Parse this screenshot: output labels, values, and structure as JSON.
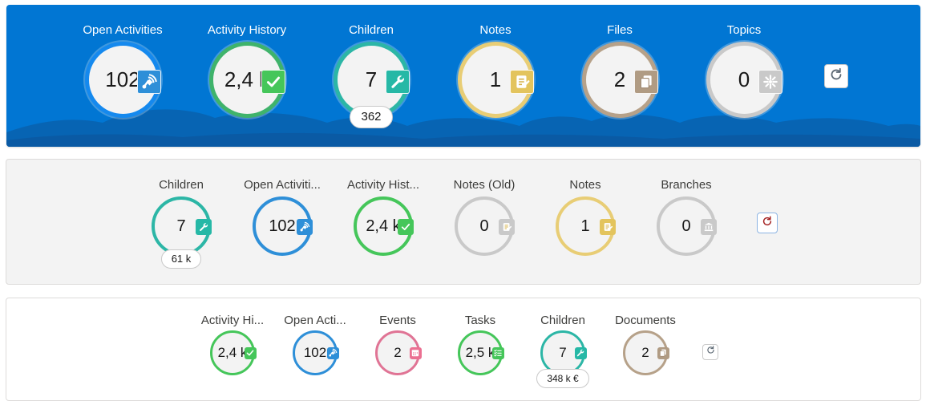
{
  "panels": [
    {
      "style": "blue",
      "tiles": [
        {
          "label": "Open Activities",
          "value": "102",
          "ring_color": "#1589ee",
          "badge_color": "#2e8fd8",
          "icon": "open-activities-icon",
          "pill": null
        },
        {
          "label": "Activity History",
          "value": "2,4 k",
          "ring_color": "#3fb36b",
          "badge_color": "#45c65a",
          "icon": "check-icon",
          "pill": null
        },
        {
          "label": "Children",
          "value": "7",
          "ring_color": "#2cb6a6",
          "badge_color": "#26b8a6",
          "icon": "wrench-icon",
          "pill": "362"
        },
        {
          "label": "Notes",
          "value": "1",
          "ring_color": "#e8cd75",
          "badge_color": "#e3c45d",
          "icon": "note-icon",
          "pill": null
        },
        {
          "label": "Files",
          "value": "2",
          "ring_color": "#b6a189",
          "badge_color": "#b09b83",
          "icon": "files-icon",
          "pill": null
        },
        {
          "label": "Topics",
          "value": "0",
          "ring_color": "#c9c9c9",
          "badge_color": "#c9c9c9",
          "icon": "topics-icon",
          "pill": null
        }
      ],
      "refresh_icon": "refresh-icon"
    },
    {
      "style": "grey",
      "tiles": [
        {
          "label": "Children",
          "value": "7",
          "ring_color": "#2cb6a6",
          "badge_color": "#26b8a6",
          "icon": "wrench-icon",
          "pill": "61 k"
        },
        {
          "label": "Open Activiti...",
          "value": "102",
          "ring_color": "#2e8fd8",
          "badge_color": "#2e8fd8",
          "icon": "open-activities-icon",
          "pill": null
        },
        {
          "label": "Activity Hist...",
          "value": "2,4 k",
          "ring_color": "#45c65a",
          "badge_color": "#45c65a",
          "icon": "check-icon",
          "pill": null
        },
        {
          "label": "Notes (Old)",
          "value": "0",
          "ring_color": "#c9c9c9",
          "badge_color": "#c9c9c9",
          "icon": "note-icon",
          "pill": null
        },
        {
          "label": "Notes",
          "value": "1",
          "ring_color": "#e8cd75",
          "badge_color": "#e3c45d",
          "icon": "note-icon",
          "pill": null
        },
        {
          "label": "Branches",
          "value": "0",
          "ring_color": "#c9c9c9",
          "badge_color": "#c9c9c9",
          "icon": "bank-icon",
          "pill": null
        }
      ],
      "refresh_icon": "refresh-icon"
    },
    {
      "style": "white",
      "tiles": [
        {
          "label": "Activity Hi...",
          "value": "2,4 k",
          "ring_color": "#45c65a",
          "badge_color": "#45c65a",
          "icon": "check-icon",
          "pill": null
        },
        {
          "label": "Open Acti...",
          "value": "102",
          "ring_color": "#2e8fd8",
          "badge_color": "#2e8fd8",
          "icon": "open-activities-icon",
          "pill": null
        },
        {
          "label": "Events",
          "value": "2",
          "ring_color": "#e07495",
          "badge_color": "#eb7092",
          "icon": "calendar-icon",
          "pill": null
        },
        {
          "label": "Tasks",
          "value": "2,5 k",
          "ring_color": "#45c65a",
          "badge_color": "#45c65a",
          "icon": "tasks-icon",
          "pill": null
        },
        {
          "label": "Children",
          "value": "7",
          "ring_color": "#2cb6a6",
          "badge_color": "#26b8a6",
          "icon": "wrench-icon",
          "pill": "348 k €"
        },
        {
          "label": "Documents",
          "value": "2",
          "ring_color": "#b6a189",
          "badge_color": "#b09b83",
          "icon": "files-icon",
          "pill": null
        }
      ],
      "refresh_icon": "refresh-icon"
    }
  ]
}
